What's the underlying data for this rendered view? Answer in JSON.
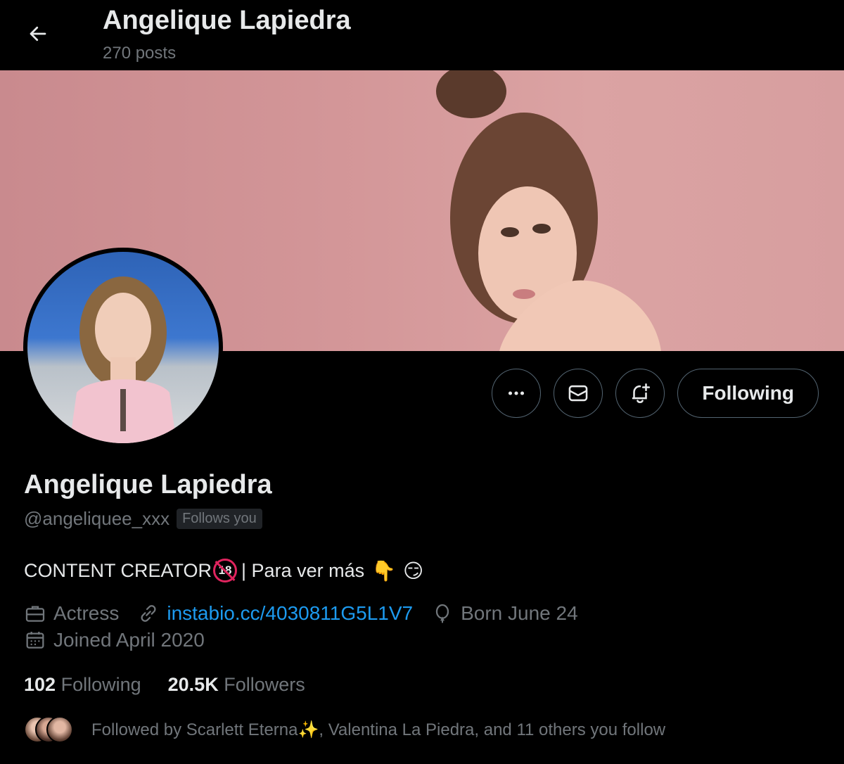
{
  "header": {
    "name": "Angelique Lapiedra",
    "posts": "270 posts"
  },
  "actions": {
    "following_label": "Following"
  },
  "profile": {
    "name": "Angelique Lapiedra",
    "handle": "@angeliquee_xxx",
    "follows_you": "Follows you",
    "bio_text": "CONTENT CREATOR",
    "bio_badge": "18",
    "bio_rest": " | Para ver más",
    "bio_emoji_1": "👇",
    "bio_emoji_2": "😏",
    "profession": "Actress",
    "link": "instabio.cc/4030811G5L1V7",
    "born": "Born June 24",
    "joined": "Joined April 2020"
  },
  "counts": {
    "following_num": "102",
    "following_label": "Following",
    "followers_num": "20.5K",
    "followers_label": "Followers"
  },
  "followed_by": "Followed by Scarlett Eterna✨, Valentina La Piedra, and 11 others you follow",
  "colors": {
    "accent": "#1d9bf0",
    "muted": "#71767b",
    "text": "#e7e9ea",
    "border": "#536471",
    "banner": "#d39698"
  }
}
